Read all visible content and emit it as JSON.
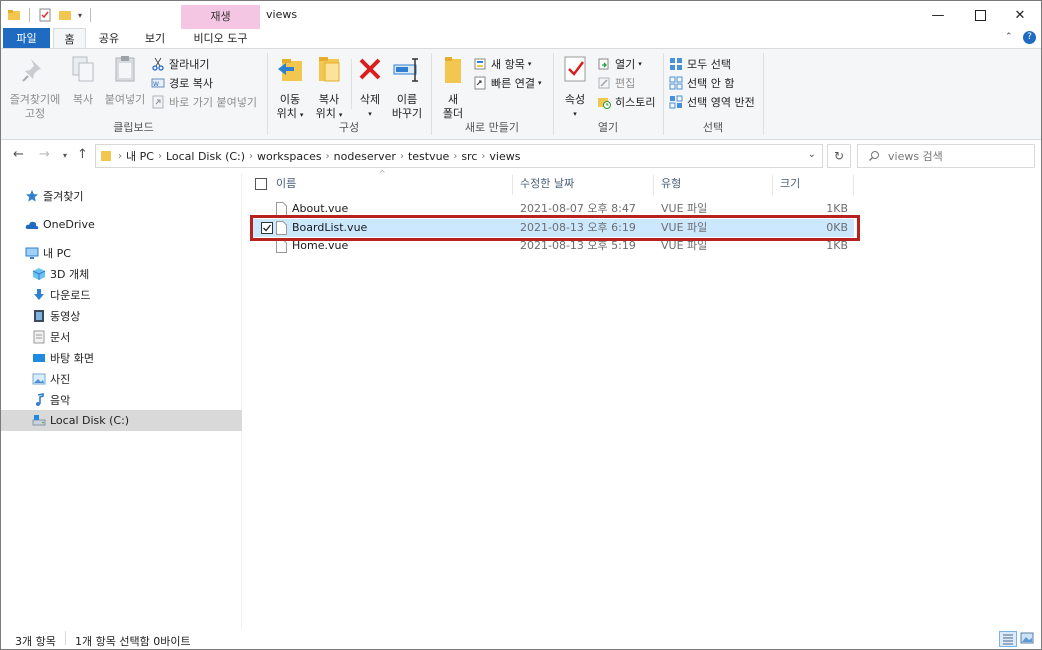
{
  "window": {
    "title": "views",
    "context_tab_header": "재생"
  },
  "ribbon_tabs": {
    "file": "파일",
    "home": "홈",
    "share": "공유",
    "view": "보기",
    "video_tools": "비디오 도구"
  },
  "ribbon": {
    "clipboard": {
      "label": "클립보드",
      "pin_line1": "즐겨찾기에",
      "pin_line2": "고정",
      "copy": "복사",
      "paste": "붙여넣기",
      "cut": "잘라내기",
      "copy_path": "경로 복사",
      "paste_shortcut": "바로 가기 붙여넣기"
    },
    "organize": {
      "label": "구성",
      "move_line1": "이동",
      "move_line2": "위치",
      "copyto_line1": "복사",
      "copyto_line2": "위치",
      "delete": "삭제",
      "rename_line1": "이름",
      "rename_line2": "바꾸기"
    },
    "new": {
      "label": "새로 만들기",
      "folder_line1": "새",
      "folder_line2": "폴더",
      "new_item": "새 항목",
      "easy_access": "빠른 연결"
    },
    "open": {
      "label": "열기",
      "properties": "속성",
      "open": "열기",
      "edit": "편집",
      "history": "히스토리"
    },
    "select": {
      "label": "선택",
      "select_all": "모두 선택",
      "select_none": "선택 안 함",
      "invert": "선택 영역 반전"
    }
  },
  "address": {
    "crumbs": [
      "내 PC",
      "Local Disk (C:)",
      "workspaces",
      "nodeserver",
      "testvue",
      "src",
      "views"
    ],
    "search_placeholder": "views 검색"
  },
  "nav": {
    "items": [
      {
        "label": "즐겨찾기",
        "icon": "star-icon"
      },
      {
        "label": "OneDrive",
        "icon": "cloud-icon"
      },
      {
        "label": "내 PC",
        "icon": "computer-icon"
      },
      {
        "label": "3D 개체",
        "icon": "cube-icon"
      },
      {
        "label": "다운로드",
        "icon": "download-icon"
      },
      {
        "label": "동영상",
        "icon": "film-icon"
      },
      {
        "label": "문서",
        "icon": "document-icon"
      },
      {
        "label": "바탕 화면",
        "icon": "desktop-icon"
      },
      {
        "label": "사진",
        "icon": "picture-icon"
      },
      {
        "label": "음악",
        "icon": "music-icon"
      },
      {
        "label": "Local Disk (C:)",
        "icon": "drive-icon"
      }
    ]
  },
  "columns": {
    "name": "이름",
    "date": "수정한 날짜",
    "type": "유형",
    "size": "크기"
  },
  "files": [
    {
      "name": "About.vue",
      "date": "2021-08-07 오후 8:47",
      "type": "VUE 파일",
      "size": "1KB"
    },
    {
      "name": "BoardList.vue",
      "date": "2021-08-13 오후 6:19",
      "type": "VUE 파일",
      "size": "0KB"
    },
    {
      "name": "Home.vue",
      "date": "2021-08-13 오후 5:19",
      "type": "VUE 파일",
      "size": "1KB"
    }
  ],
  "status": {
    "item_count": "3개 항목",
    "selection": "1개 항목 선택함 0바이트"
  },
  "colors": {
    "file_tab": "#1f6bc1",
    "context_tab": "#f5c6e3",
    "selection": "#cce8ff",
    "highlight_border": "#b7211e"
  }
}
